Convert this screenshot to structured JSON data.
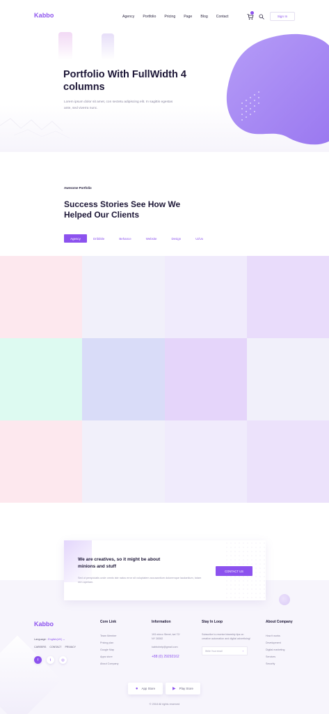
{
  "header": {
    "logo": "Kabbo",
    "nav": [
      "Agency",
      "Portfolio",
      "Pricing",
      "Page",
      "Blog",
      "Contact"
    ],
    "signin_label": "Sign In",
    "cart_icon": "cart-icon",
    "search_icon": "search-icon"
  },
  "hero": {
    "title": "Portfolio With FullWidth 4 columns",
    "description": "Lorem ipsum dolor sit amet, con sectetu adipiscing elit. In sagittis egestas ante, sed viverra nunc."
  },
  "portfolio": {
    "eyebrow": "Awesome Portfolio",
    "title": "Success Stories See How We Helped Our Clients",
    "filters": [
      "Agency",
      "Dribbble",
      "Behance",
      "Website",
      "Design",
      "Ui/Ux"
    ],
    "active_filter": "Agency",
    "tile_colors": [
      "#fde8ee",
      "#f1f0fa",
      "#f0ebfc",
      "#e9dcfb",
      "#ddfaf1",
      "#d9dcf8",
      "#e5d5fa",
      "#f1f0fa",
      "#fde8ee",
      "#f1f0fa",
      "#f0ebfc",
      "#ece2fb"
    ]
  },
  "cta": {
    "title": "We are creatives, so it might be about minions and stuff",
    "description": "Sed ut perspiciatis unde omnis iste natus error sit voluptatem accusantium doloremque laudantium, totam rem aperiam.",
    "button_label": "CONTACT US"
  },
  "footer": {
    "logo": "Kabbo",
    "language_label": "Language :",
    "language_value": "English(UK) ⌄",
    "links": [
      "CAREERS",
      "CONTACT",
      "PRIVACY"
    ],
    "social": [
      "f",
      "t",
      "◎"
    ],
    "core_link": {
      "title": "Core Link",
      "items": [
        "Team Member",
        "Pricing plan",
        "Google Map",
        "Apps store",
        "About Company"
      ]
    },
    "information": {
      "title": "Information",
      "address_line1": "193 mirror Street, kal 72/",
      "address_line2": "NY 28382",
      "email": "kabbohelp@gmail.com",
      "phone": "+88 (0) 29292162"
    },
    "stay_in_loop": {
      "title": "Stay In  Loop",
      "text": "Subscribe to receive biweekly tips on creative automation and digital advertising!",
      "placeholder": "Write Your email",
      "arrow": "›"
    },
    "about_company": {
      "title": "About Company",
      "items": [
        "How it works",
        "Development",
        "Digital marketing",
        "Services",
        "Security"
      ]
    },
    "app_store": "App Store",
    "play_store": "Play Store",
    "copyright": "© 2018 All rights reserved"
  },
  "colors": {
    "accent": "#8c52ee",
    "dark": "#1c1636",
    "muted": "#8a86a0"
  }
}
